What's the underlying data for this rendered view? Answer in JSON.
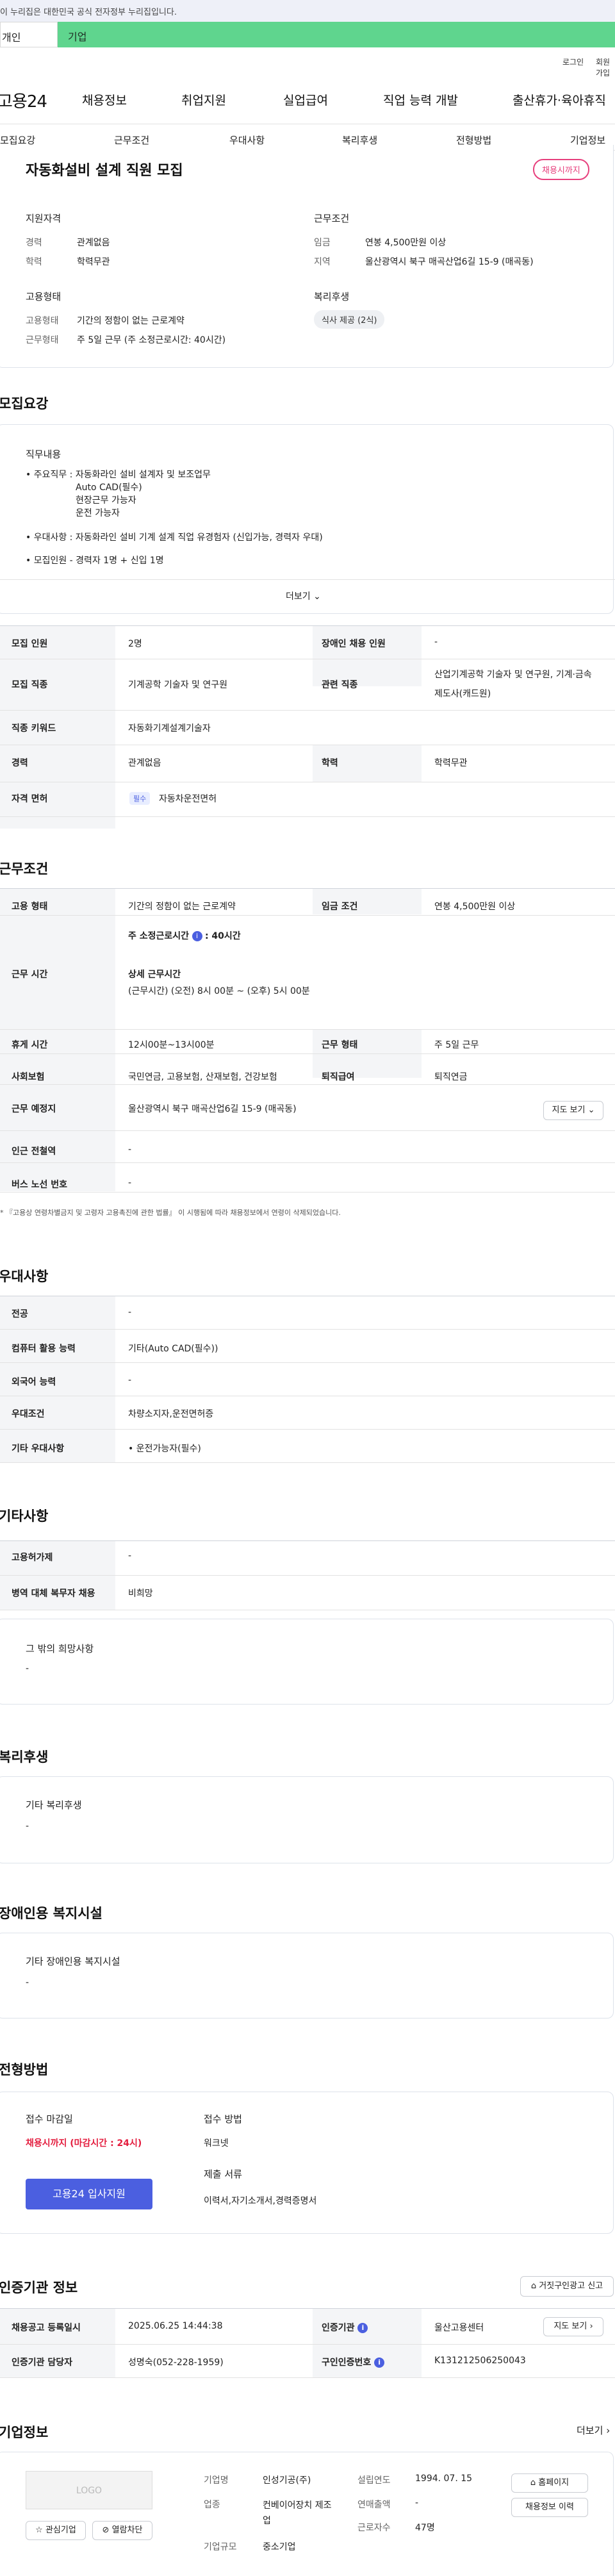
{
  "gov_banner": "이 누리집은 대한민국 공식 전자정부 누리집입니다.",
  "top_tabs": {
    "left": "개인",
    "right": "기업"
  },
  "util": {
    "login": "로그인",
    "signup": "회원가입"
  },
  "header": {
    "logo": "고용24",
    "gnb": [
      "채용정보",
      "취업지원",
      "실업급여",
      "직업 능력 개발",
      "출산휴가·육아휴직"
    ]
  },
  "subnav": [
    "모집요강",
    "근무조건",
    "우대사항",
    "복리후생",
    "전형방법",
    "기업정보"
  ],
  "summary": {
    "title": "자동화설비 설계 직원 모집",
    "status_badge": "채용시까지",
    "qual": {
      "heading": "지원자격",
      "rows": [
        {
          "k": "경력",
          "v": "관계없음"
        },
        {
          "k": "학력",
          "v": "학력무관"
        }
      ]
    },
    "cond": {
      "heading": "근무조건",
      "rows": [
        {
          "k": "임금",
          "v": "연봉 4,500만원 이상"
        },
        {
          "k": "지역",
          "v": "울산광역시 북구 매곡산업6길 15-9 (매곡동)"
        }
      ]
    },
    "emp": {
      "heading": "고용형태",
      "rows": [
        {
          "k": "고용형태",
          "v": "기간의 정함이 없는 근로계약"
        },
        {
          "k": "근무형태",
          "v": "주 5일 근무 (주 소정근로시간: 40시간)"
        }
      ]
    },
    "welfare": {
      "heading": "복리후생",
      "chip": "식사 제공 (2식)"
    }
  },
  "recruit": {
    "section_title": "모집요강",
    "job_heading": "직무내용",
    "job_lines": [
      "• 주요직무 : 자동화라인 설비 설계자 및 보조업무",
      "Auto CAD(필수)",
      "현장근무 가능자",
      "운전 가능자",
      "• 우대사항 : 자동화라인 설비 기계 설계 직업 유경험자 (신입가능, 경력자 우대)",
      "• 모집인원 - 경력자 1명 + 신입 1명"
    ],
    "more": "더보기",
    "table": {
      "r1": {
        "k1": "모집 인원",
        "v1": "2명",
        "k2": "장애인 채용 인원",
        "v2": "-"
      },
      "r2": {
        "k1": "모집 직종",
        "v1": "기계공학 기술자 및 연구원",
        "k2": "관련 직종",
        "v2a": "산업기계공학 기술자 및 연구원, 기계·금속",
        "v2b": "제도사(캐드원)"
      },
      "r3": {
        "k1": "직종 키워드",
        "v1": "자동화기계설계기술자"
      },
      "r4": {
        "k1": "경력",
        "v1": "관계없음",
        "k2": "학력",
        "v2": "학력무관"
      },
      "r5": {
        "k1": "자격 면허",
        "tag": "필수",
        "v1": "자동차운전면허"
      }
    }
  },
  "work": {
    "section_title": "근무조건",
    "r1": {
      "k1": "고용 형태",
      "v1": "기간의 정함이 없는 근로계약",
      "k2": "임금 조건",
      "v2": "연봉 4,500만원 이상"
    },
    "r2": {
      "k1": "근무 시간",
      "weekly_label": "주 소정근로시간",
      "weekly_value": ": 40시간",
      "detail_label": "상세 근무시간",
      "detail_value": "(근무시간) (오전) 8시 00분 ~ (오후) 5시 00분"
    },
    "r3": {
      "k1": "휴게 시간",
      "v1": "12시00분~13시00분",
      "k2": "근무 형태",
      "v2": "주 5일 근무"
    },
    "r4": {
      "k1": "사회보험",
      "v1": "국민연금, 고용보험, 산재보험, 건강보험",
      "k2": "퇴직급여",
      "v2": "퇴직연금"
    },
    "r5": {
      "k1": "근무 예정지",
      "v1": "울산광역시 북구 매곡산업6길 15-9 (매곡동)",
      "btn": "지도 보기"
    },
    "r6": {
      "k1": "인근 전철역",
      "v1": "-"
    },
    "r7": {
      "k1": "버스 노선 번호",
      "v1": "-"
    },
    "note": "* 『고용상 연령차별금지 및 고령자 고용촉진에 관한 법률』 이 시행됨에 따라 채용정보에서 연령이 삭제되었습니다."
  },
  "pref": {
    "section_title": "우대사항",
    "rows": [
      {
        "k": "전공",
        "v": "-"
      },
      {
        "k": "컴퓨터 활용 능력",
        "v": "기타(Auto CAD(필수))"
      },
      {
        "k": "외국어 능력",
        "v": "-"
      },
      {
        "k": "우대조건",
        "v": "차량소지자,운전면허증"
      },
      {
        "k": "기타 우대사항",
        "v": "• 운전가능자(필수)"
      }
    ]
  },
  "etc": {
    "section_title": "기타사항",
    "rows": [
      {
        "k": "고용허가제",
        "v": "-"
      },
      {
        "k": "병역 대체 복무자 채용",
        "v": "비희망"
      }
    ],
    "box_title": "그 밖의 희망사항",
    "box_value": "-"
  },
  "welfare": {
    "section_title": "복리후생",
    "box_title": "기타 복리후생",
    "box_value": "-"
  },
  "disabled": {
    "section_title": "장애인용 복지시설",
    "box_title": "기타 장애인용 복지시설",
    "box_value": "-"
  },
  "selection": {
    "section_title": "전형방법",
    "deadline_label": "접수 마감일",
    "deadline_value": "채용시까지 (마감시간 : 24시)",
    "apply_button": "고용24 입사지원",
    "method_label": "접수 방법",
    "method_value": "워크넷",
    "docs_label": "제출 서류",
    "docs_value": "이력서,자기소개서,경력증명서"
  },
  "agency": {
    "section_title": "인증기관 정보",
    "report_btn": "거짓구인광고 신고",
    "r1": {
      "k1": "채용공고 등록일시",
      "v1": "2025.06.25 14:44:38",
      "k2": "인증기관",
      "v2": "울산고용센터",
      "btn": "지도 보기"
    },
    "r2": {
      "k1": "인증기관 담당자",
      "v1": "성명숙(052-228-1959)",
      "k2": "구인인증번호",
      "v2": "K131212506250043"
    }
  },
  "company": {
    "section_title": "기업정보",
    "more": "더보기",
    "logo_text": "LOGO",
    "fav_btn": "관심기업",
    "block_btn": "열람차단",
    "col1": [
      {
        "k": "기업명",
        "v": "인성기공(주)"
      },
      {
        "k": "업종",
        "v": "컨베이어장치 제조업"
      },
      {
        "k": "기업규모",
        "v": "중소기업"
      }
    ],
    "col2": [
      {
        "k": "설립연도",
        "v": "1994. 07. 15"
      },
      {
        "k": "연매출액",
        "v": "-"
      },
      {
        "k": "근로자수",
        "v": "47명"
      }
    ],
    "homepage_btn": "홈페이지",
    "history_btn": "채용정보 이력"
  }
}
